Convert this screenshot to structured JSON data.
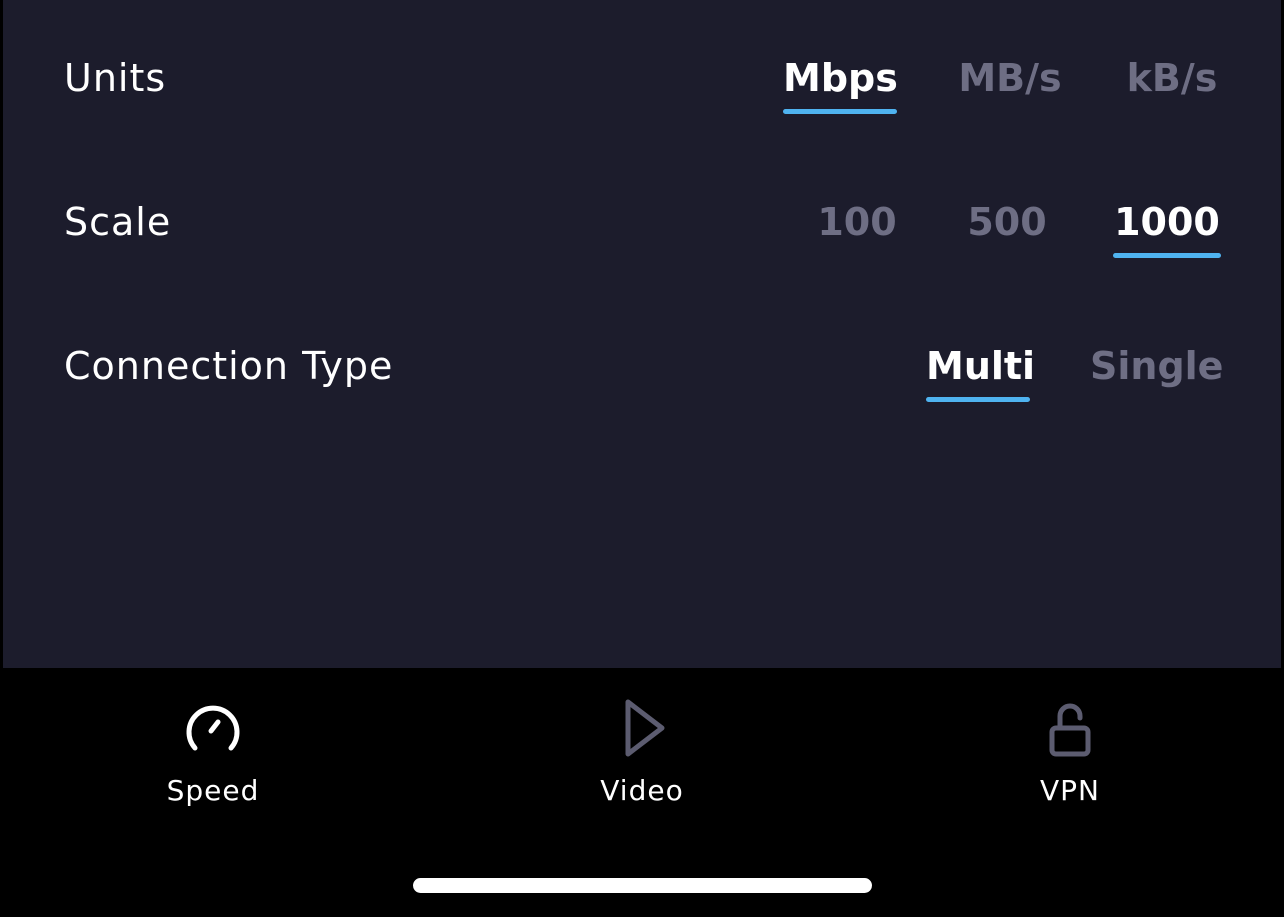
{
  "settings": {
    "units": {
      "label": "Units",
      "options": [
        "Mbps",
        "MB/s",
        "kB/s"
      ],
      "selected": "Mbps"
    },
    "scale": {
      "label": "Scale",
      "options": [
        "100",
        "500",
        "1000"
      ],
      "selected": "1000"
    },
    "connection_type": {
      "label": "Connection Type",
      "options": [
        "Multi",
        "Single"
      ],
      "selected": "Multi"
    }
  },
  "tab_bar": {
    "tabs": [
      {
        "label": "Speed",
        "icon": "speedometer-icon",
        "active": true
      },
      {
        "label": "Video",
        "icon": "play-icon",
        "active": false
      },
      {
        "label": "VPN",
        "icon": "unlock-icon",
        "active": false
      }
    ]
  },
  "colors": {
    "panel_background": "#1c1c2c",
    "accent_underline": "#4fb3f0",
    "selected_text": "#ffffff",
    "unselected_text": "#6e6e84",
    "inactive_icon": "#5c5c70"
  }
}
